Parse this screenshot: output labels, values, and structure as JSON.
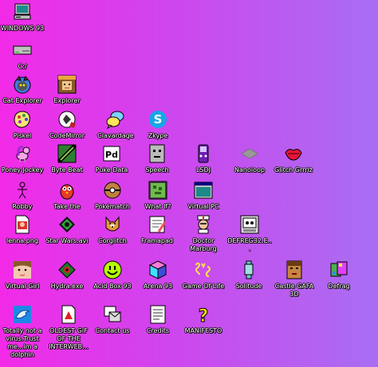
{
  "desktop": {
    "icons": [
      {
        "label": "WINDOWS 93",
        "icon": "computer-icon"
      },
      {
        "label": "C:/",
        "icon": "drive-icon"
      },
      {
        "label": "Cat Explorer",
        "icon": "cat-explorer-icon"
      },
      {
        "label": "Explorer",
        "icon": "explorer-icon"
      },
      {
        "label": "Piskel",
        "icon": "piskel-icon"
      },
      {
        "label": "CodeMirror",
        "icon": "codemirror-icon"
      },
      {
        "label": "Clavardage",
        "icon": "chat-icon"
      },
      {
        "label": "Zkype",
        "icon": "zkype-icon"
      },
      {
        "label": "Poney Jockey",
        "icon": "pony-icon"
      },
      {
        "label": "Byte Beat",
        "icon": "bytebeat-icon"
      },
      {
        "label": "Puke Data",
        "icon": "pukedata-icon"
      },
      {
        "label": "Speech",
        "icon": "speech-icon"
      },
      {
        "label": "LSDJ",
        "icon": "lsdj-icon"
      },
      {
        "label": "Nanoloop",
        "icon": "nanoloop-icon"
      },
      {
        "label": "Glitch Grrrlz",
        "icon": "glitch-lips-icon"
      },
      {
        "label": "Robby",
        "icon": "stickman-icon"
      },
      {
        "label": "Take the",
        "icon": "parrot-icon"
      },
      {
        "label": "Pokématch",
        "icon": "pokeball-icon"
      },
      {
        "label": "What If?",
        "icon": "whatif-icon"
      },
      {
        "label": "Virtual PC",
        "icon": "virtualpc-icon"
      },
      {
        "label": "lenna.png",
        "icon": "image-file-icon"
      },
      {
        "label": "Star Wars.avi",
        "icon": "starwars-icon"
      },
      {
        "label": "Corglitch",
        "icon": "corgi-icon"
      },
      {
        "label": "Framapad",
        "icon": "framapad-icon"
      },
      {
        "label": "Doctor Marburg",
        "icon": "doctor-icon"
      },
      {
        "label": "DEFREG32.E...",
        "icon": "defreg-icon"
      },
      {
        "label": "Virtual Girl",
        "icon": "virtualgirl-icon"
      },
      {
        "label": "Hydra.exe",
        "icon": "hydra-icon"
      },
      {
        "label": "Acid Box 93",
        "icon": "smiley-icon"
      },
      {
        "label": "Arena 93",
        "icon": "cube-icon"
      },
      {
        "label": "Game Of Life",
        "icon": "gameoflife-icon"
      },
      {
        "label": "Solitude",
        "icon": "solitude-icon"
      },
      {
        "label": "Castle GAFA 3D",
        "icon": "castle-icon"
      },
      {
        "label": "Defrag",
        "icon": "defrag-icon"
      },
      {
        "label": "Totally not a virus.Trust me...im a dolphin",
        "icon": "dolphin-icon"
      },
      {
        "label": "OLDEST GIF OF THE INTERWEB...",
        "icon": "gif-file-icon"
      },
      {
        "label": "Contact us",
        "icon": "contact-icon"
      },
      {
        "label": "Credits",
        "icon": "credits-icon"
      },
      {
        "label": "MANIFESTO",
        "icon": "question-icon"
      }
    ]
  }
}
